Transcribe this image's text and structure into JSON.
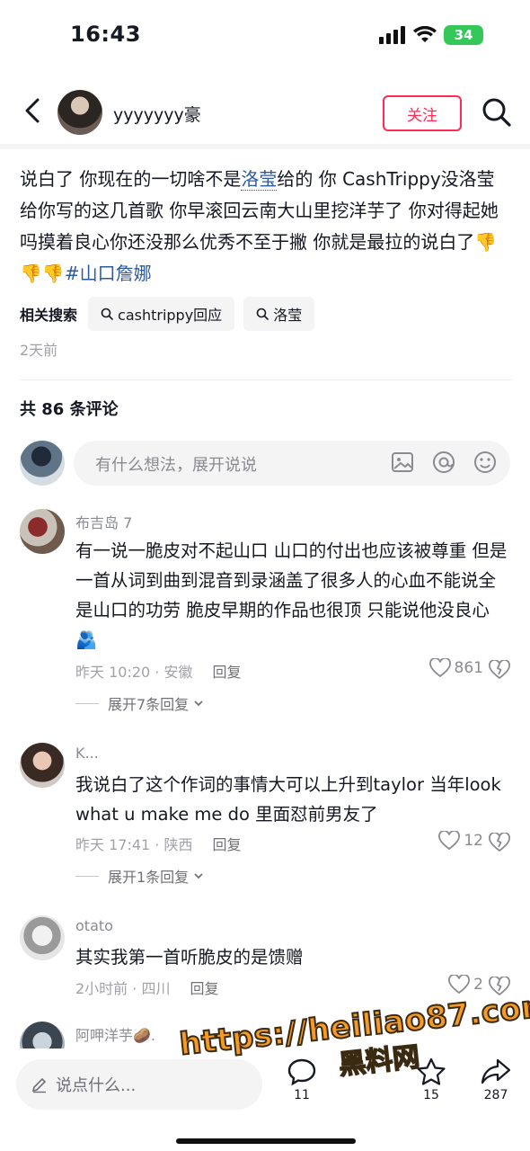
{
  "status_bar": {
    "time": "16:43",
    "battery": "34"
  },
  "header": {
    "username": "yyyyyyy豪",
    "follow_label": "关注"
  },
  "post": {
    "part1": "说白了 你现在的一切啥不是",
    "kw": "洛莹",
    "part2": "给的 你 CashTrippy没洛莹给你写的这几首歌 你早滚回云南大山里挖洋芋了 你对得起她吗摸着良心你还没那么优秀不至于撇 你就是最拉的说白了",
    "emoji": "👎👎👎",
    "hashtag": "#山口詹娜",
    "related_label": "相关搜索",
    "related": [
      "cashtrippy回应",
      "洛莹"
    ],
    "time": "2天前"
  },
  "comments_header": {
    "count": "共 86 条评论"
  },
  "input": {
    "placeholder": "有什么想法，展开说说"
  },
  "comments": [
    {
      "name": "布吉岛 7",
      "text": "有一说一脆皮对不起山口 山口的付出也应该被尊重 但是一首从词到曲到混音到录涵盖了很多人的心血不能说全是山口的功劳 脆皮早期的作品也很顶 只能说他没良心🫂",
      "meta": "昨天 10:20 · 安徽",
      "reply": "回复",
      "likes": "861",
      "expand": "展开7条回复"
    },
    {
      "name": "K...",
      "text": "我说白了这个作词的事情大可以上升到taylor 当年look what u make me do 里面怼前男友了",
      "meta": "昨天 17:41 · 陕西",
      "reply": "回复",
      "likes": "12",
      "expand": "展开1条回复"
    },
    {
      "name": "otato",
      "text": "其实我第一首听脆皮的是馈赠",
      "meta": "2小时前 · 四川",
      "reply": "回复",
      "likes": "2"
    },
    {
      "name": "阿呷洋芋🥔."
    }
  ],
  "bottom": {
    "say_placeholder": "说点什么...",
    "comments_count": "11",
    "stars": "15",
    "shares": "287"
  },
  "watermark": {
    "url": "https://heiliao87.com",
    "cn": "黑料网"
  },
  "colors": {
    "accent": "#fe2c55",
    "link": "#2b5aa0",
    "watermark": "#f59a23"
  }
}
